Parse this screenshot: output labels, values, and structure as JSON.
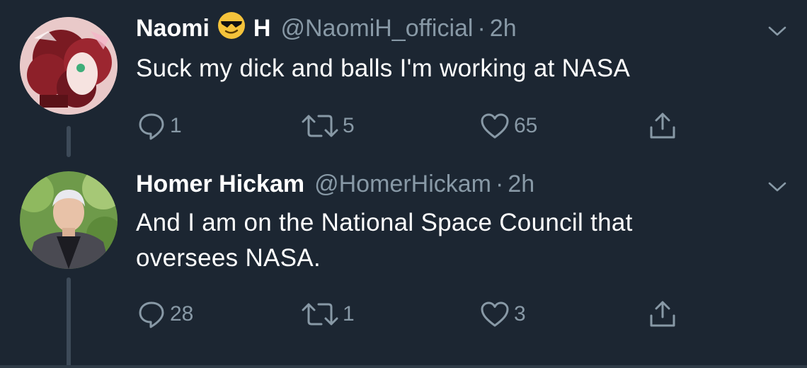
{
  "tweets": [
    {
      "display_name": "Naomi",
      "display_name_suffix": "H",
      "emoji": "sunglasses-emoji",
      "handle": "@NaomiH_official",
      "time": "2h",
      "text": "Suck my dick and balls I'm working at NASA",
      "replies": "1",
      "retweets": "5",
      "likes": "65"
    },
    {
      "display_name": "Homer Hickam",
      "handle": "@HomerHickam",
      "time": "2h",
      "text": "And I am on the National Space Council that\noversees NASA.",
      "replies": "28",
      "retweets": "1",
      "likes": "3"
    }
  ],
  "separator": "·",
  "icons": {
    "reply": "reply-icon",
    "retweet": "retweet-icon",
    "like": "heart-icon",
    "share": "share-icon",
    "menu": "chevron-down-icon"
  },
  "colors": {
    "background": "#1c2632",
    "text_primary": "#ffffff",
    "text_secondary": "#8899a6",
    "thread_line": "#3d4a58"
  }
}
